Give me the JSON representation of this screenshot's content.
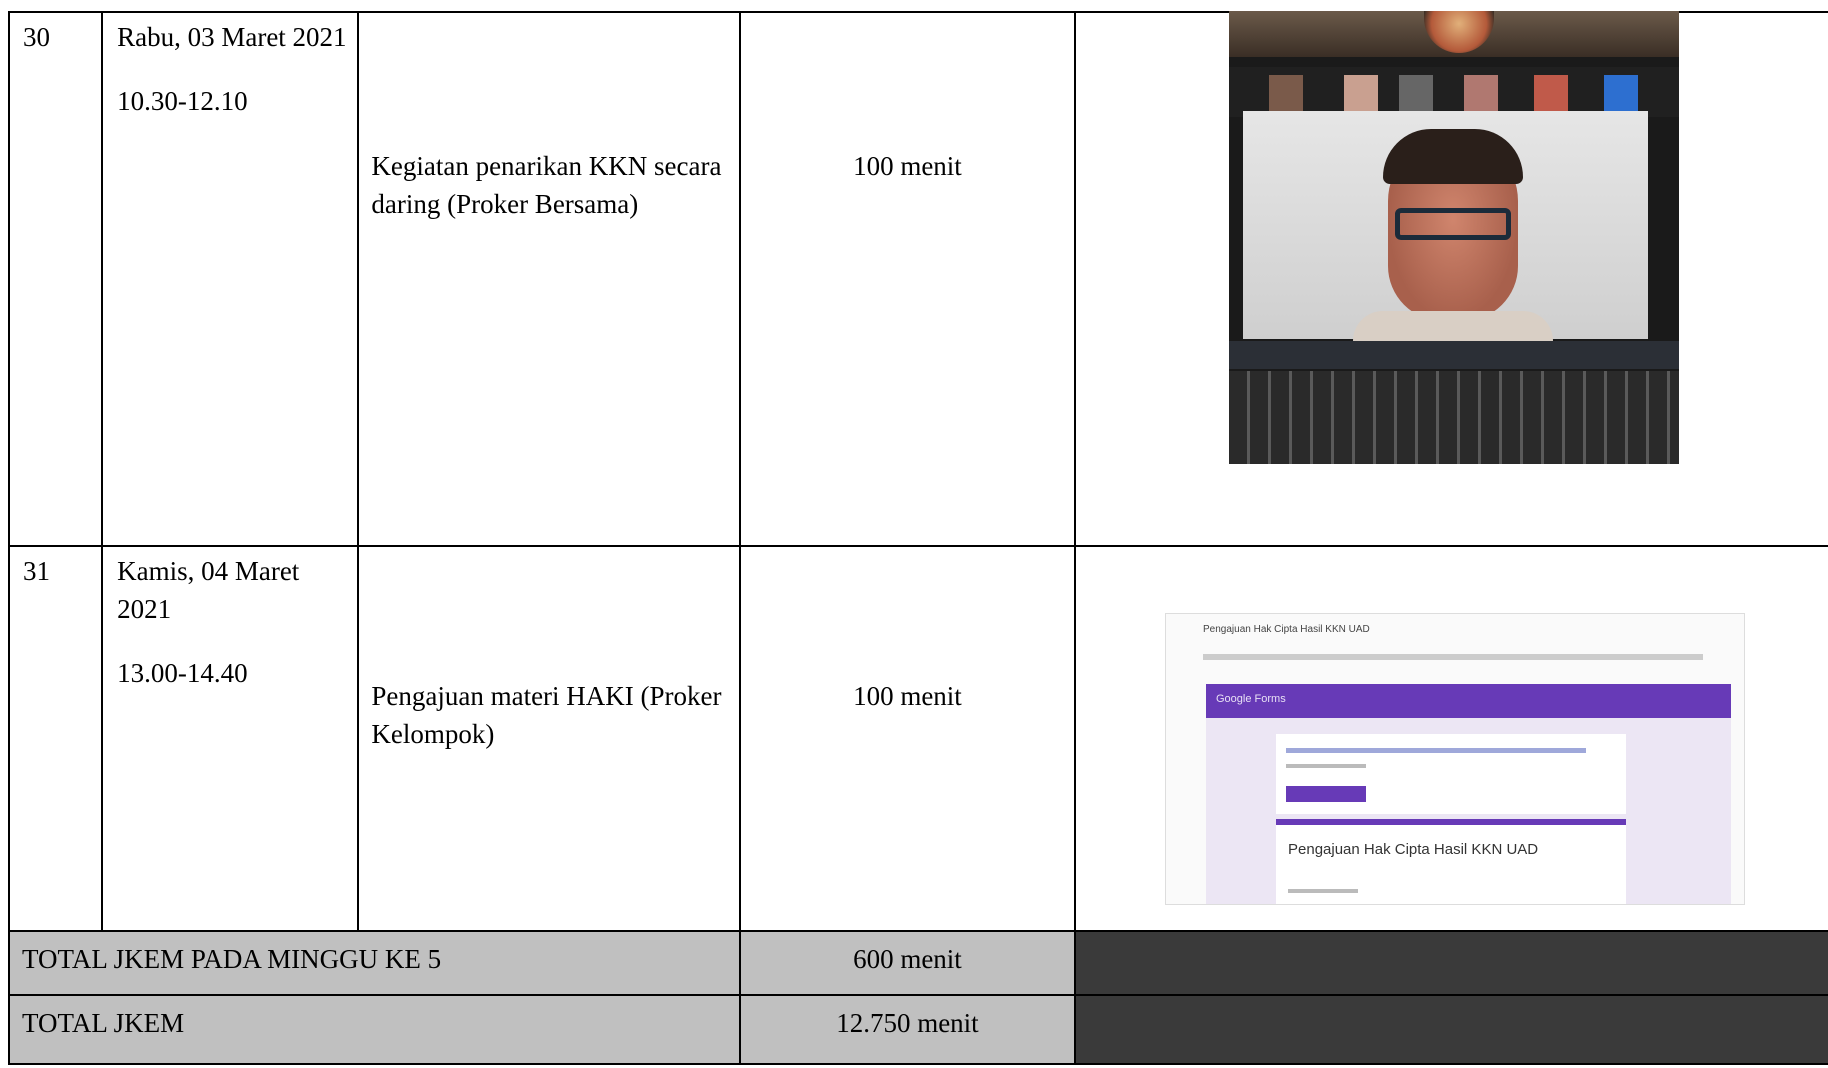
{
  "rows": [
    {
      "no": "30",
      "date": "Rabu, 03 Maret 2021",
      "time": "10.30-12.10",
      "activity": "Kegiatan penarikan KKN secara daring (Proker Bersama)",
      "duration": "100 menit",
      "photo": "zoom-meeting-screenshot"
    },
    {
      "no": "31",
      "date": "Kamis, 04 Maret 2021",
      "time": "13.00-14.40",
      "activity": "Pengajuan materi HAKI (Proker Kelompok)",
      "duration": "100 menit",
      "photo": "google-forms-screenshot"
    }
  ],
  "totals": [
    {
      "label": "TOTAL JKEM PADA MINGGU KE 5",
      "value": "600 menit"
    },
    {
      "label": "TOTAL JKEM",
      "value": "12.750 menit"
    }
  ],
  "forms_screenshot": {
    "subject": "Pengajuan Hak Cipta Hasil KKN UAD",
    "brand": "Google Forms",
    "form_title": "Pengajuan Hak Cipta Hasil KKN UAD",
    "accent_color": "#673ab7"
  }
}
